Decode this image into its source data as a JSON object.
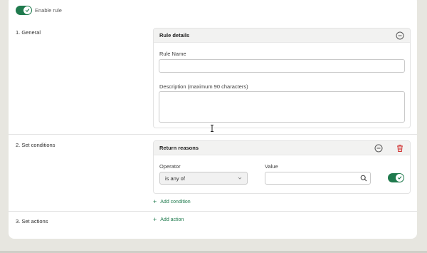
{
  "enable_rule": {
    "label": "Enable rule",
    "checked": true
  },
  "sections": {
    "general": {
      "label": "1. General"
    },
    "conditions": {
      "label": "2. Set conditions"
    },
    "actions": {
      "label": "3. Set actions"
    }
  },
  "rule_details": {
    "title": "Rule details",
    "rule_name_label": "Rule Name",
    "rule_name_value": "",
    "description_label": "Description (maximum 90 characters)",
    "description_value": ""
  },
  "conditions": {
    "title": "Return reasons",
    "operator_label": "Operator",
    "operator_value": "is any of",
    "value_label": "Value",
    "value_value": "",
    "toggle_checked": true,
    "add_condition": "Add condition"
  },
  "actions": {
    "add_action": "Add action"
  },
  "colors": {
    "accent": "#1f7a4d",
    "delete": "#d03030",
    "page_bg": "#e7e6e0"
  }
}
